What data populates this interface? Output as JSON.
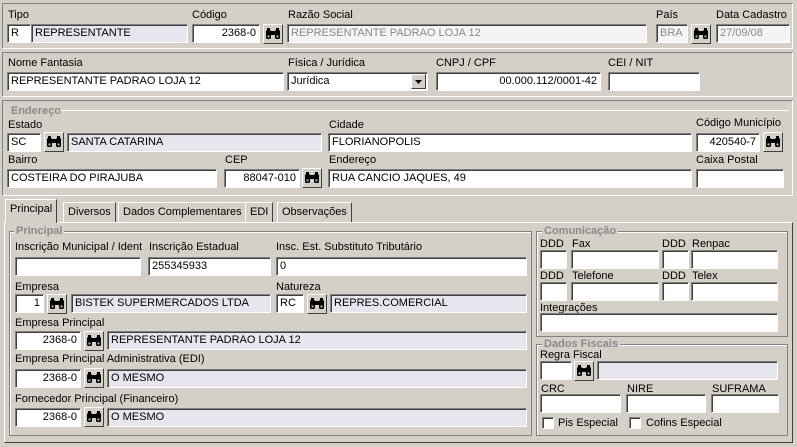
{
  "header": {
    "tipo_label": "Tipo",
    "tipo_code": "R",
    "tipo_value": "REPRESENTANTE",
    "codigo_label": "Código",
    "codigo_value": "2368-0",
    "razao_label": "Razão Social",
    "razao_value": "REPRESENTANTE PADRAO LOJA 12",
    "pais_label": "País",
    "pais_value": "BRA",
    "data_label": "Data Cadastro",
    "data_value": "27/09/08"
  },
  "row2": {
    "fantasia_label": "Nome Fantasia",
    "fantasia_value": "REPRESENTANTE PADRAO LOJA 12",
    "fisica_label": "Física / Jurídica",
    "fisica_value": "Jurídica",
    "cnpj_label": "CNPJ / CPF",
    "cnpj_value": "00.000.112/0001-42",
    "cei_label": "CEI / NIT",
    "cei_value": ""
  },
  "endereco": {
    "title": "Endereço",
    "estado_label": "Estado",
    "estado_code": "SC",
    "estado_name": "SANTA CATARINA",
    "cidade_label": "Cidade",
    "cidade_value": "FLORIANOPOLIS",
    "cod_mun_label": "Código Município",
    "cod_mun_value": "420540-7",
    "bairro_label": "Bairro",
    "bairro_value": "COSTEIRA DO PIRAJUBA",
    "cep_label": "CEP",
    "cep_value": "88047-010",
    "endereco_label": "Endereço",
    "endereco_value": "RUA CANCIO JAQUES, 49",
    "caixa_label": "Caixa Postal",
    "caixa_value": ""
  },
  "tabs": [
    "Principal",
    "Diversos",
    "Dados Complementares",
    "EDI",
    "Observações"
  ],
  "principal": {
    "title": "Principal",
    "insc_mun_label": "Inscrição Municipal / Ident",
    "insc_mun_value": "",
    "insc_est_label": "Inscrição Estadual",
    "insc_est_value": "255345933",
    "insc_sub_label": "Insc. Est. Substituto Tributário",
    "insc_sub_value": "0",
    "empresa_label": "Empresa",
    "empresa_code": "1",
    "empresa_name": "BISTEK SUPERMERCADOS LTDA",
    "natureza_label": "Natureza",
    "natureza_code": "RC",
    "natureza_name": "REPRES.COMERCIAL",
    "emp_principal_label": "Empresa Principal",
    "emp_principal_code": "2368-0",
    "emp_principal_name": "REPRESENTANTE PADRAO LOJA 12",
    "emp_adm_label": "Empresa Principal Administrativa (EDI)",
    "emp_adm_code": "2368-0",
    "emp_adm_name": "O MESMO",
    "fornecedor_label": "Fornecedor Principal (Financeiro)",
    "fornecedor_code": "2368-0",
    "fornecedor_name": "O MESMO"
  },
  "comunicacao": {
    "title": "Comunicação",
    "ddd_label": "DDD",
    "fax_label": "Fax",
    "renpac_label": "Renpac",
    "telefone_label": "Telefone",
    "telex_label": "Telex",
    "integracoes_label": "Integrações"
  },
  "fiscais": {
    "title": "Dados Fiscais",
    "regra_label": "Regra Fiscal",
    "crc_label": "CRC",
    "nire_label": "NIRE",
    "suframa_label": "SUFRAMA",
    "pis_label": "Pis Especial",
    "cofins_label": "Cofins Especial"
  },
  "icons": {
    "search": "binoculars-icon",
    "dropdown": "chevron-down-icon"
  }
}
